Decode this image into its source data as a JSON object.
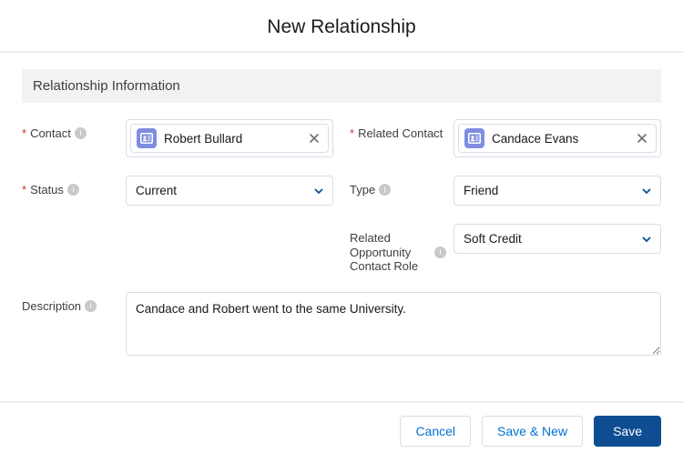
{
  "header": {
    "title": "New Relationship"
  },
  "section": {
    "title": "Relationship Information"
  },
  "fields": {
    "contact": {
      "label": "Contact",
      "value": "Robert Bullard"
    },
    "related_contact": {
      "label": "Related Contact",
      "value": "Candace Evans"
    },
    "status": {
      "label": "Status",
      "value": "Current"
    },
    "type": {
      "label": "Type",
      "value": "Friend"
    },
    "related_opp_role": {
      "label": "Related Opportunity Contact Role",
      "value": "Soft Credit"
    },
    "description": {
      "label": "Description",
      "value": "Candace and Robert went to the same University."
    }
  },
  "footer": {
    "cancel": "Cancel",
    "save_and_new": "Save & New",
    "save": "Save"
  }
}
